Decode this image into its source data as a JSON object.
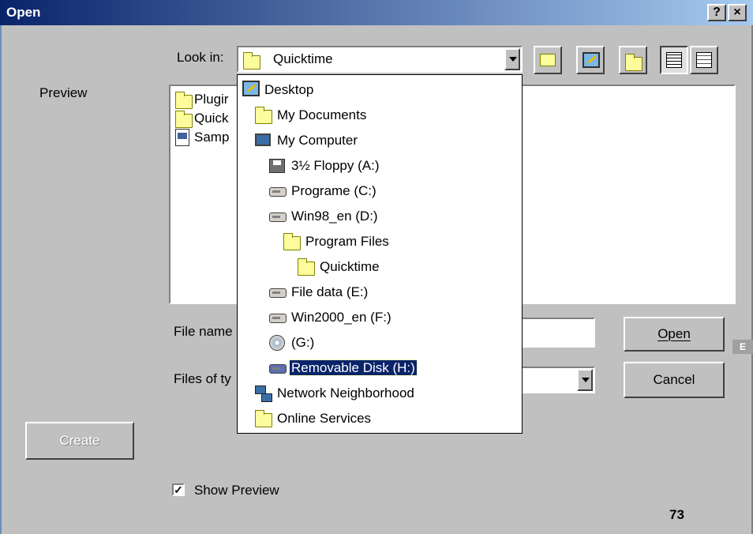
{
  "window": {
    "title": "Open",
    "help_button": "?",
    "close_button": "×"
  },
  "look_in": {
    "label": "Look in:",
    "value": "Quicktime"
  },
  "preview_label": "Preview",
  "file_list": [
    {
      "name": "Plugir",
      "icon": "folder-icon"
    },
    {
      "name": "Quick",
      "icon": "folder-icon"
    },
    {
      "name": "Samp",
      "icon": "movie-file-icon"
    }
  ],
  "dropdown_items": [
    {
      "label": "Desktop",
      "icon": "desktop-icon",
      "indent": 0
    },
    {
      "label": "My Documents",
      "icon": "open-folder-icon",
      "indent": 1
    },
    {
      "label": "My Computer",
      "icon": "computer-icon",
      "indent": 1
    },
    {
      "label": "3½ Floppy (A:)",
      "icon": "floppy-icon",
      "indent": 2
    },
    {
      "label": "Programe (C:)",
      "icon": "drive-icon",
      "indent": 2
    },
    {
      "label": "Win98_en (D:)",
      "icon": "drive-icon",
      "indent": 2
    },
    {
      "label": "Program Files",
      "icon": "folder-icon",
      "indent": 3
    },
    {
      "label": "Quicktime",
      "icon": "open-folder-icon",
      "indent": 4
    },
    {
      "label": "File data (E:)",
      "icon": "drive-icon",
      "indent": 2
    },
    {
      "label": "Win2000_en (F:)",
      "icon": "drive-icon",
      "indent": 2
    },
    {
      "label": "(G:)",
      "icon": "cd-drive-icon",
      "indent": 2
    },
    {
      "label": "Removable Disk (H:)",
      "icon": "removable-disk-icon",
      "indent": 2,
      "selected": true
    },
    {
      "label": "Network Neighborhood",
      "icon": "network-icon",
      "indent": 1
    },
    {
      "label": "Online Services",
      "icon": "folder-icon",
      "indent": 1
    }
  ],
  "file_name": {
    "label": "File name",
    "value": ""
  },
  "files_of_type": {
    "label": "Files of ty",
    "value": ""
  },
  "buttons": {
    "open": "Open",
    "cancel": "Cancel",
    "create": "Create"
  },
  "show_preview": {
    "label": "Show Preview",
    "checked": true
  },
  "page_number": "73",
  "side_tab": "E"
}
